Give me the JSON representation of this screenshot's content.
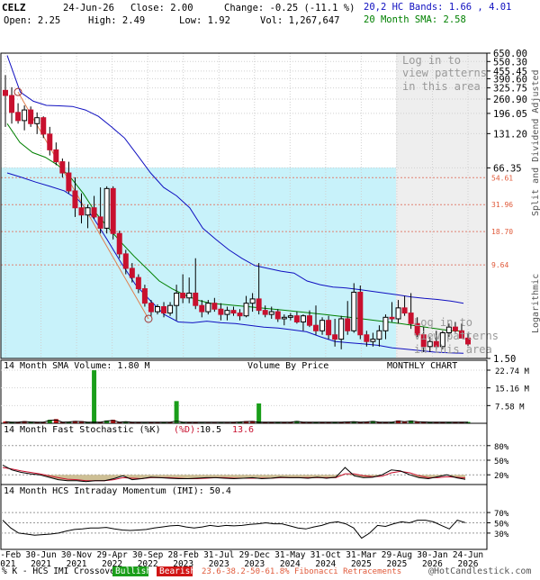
{
  "header": {
    "symbol": "CELZ",
    "date": "24-Jun-26",
    "close": "Close: 2.00",
    "change": "Change: -0.25 (-11.1 %)",
    "open": "Open: 2.25",
    "high": "High: 2.49",
    "low": "Low: 1.92",
    "vol": "Vol: 1,267,647",
    "bands": "20,2 HC Bands: 1.66 , 4.01",
    "sma": "20 Month SMA: 2.58"
  },
  "colors": {
    "up": "#ffffff",
    "down": "#c8102e",
    "bands": "#1010c0",
    "sma": "#008000",
    "fib_zone": "#c8f2fa",
    "right_zone": "#eeeeee",
    "fib_line": "#e08070",
    "vol_up": "#1a9e1a",
    "vol_down": "#d01515",
    "stoch_k": "#000000",
    "stoch_d": "#c8102e",
    "stoch_fill": "#cdbf95",
    "grid": "#d0d0d0"
  },
  "texts": {
    "login_top": [
      "Log in to",
      "view patterns",
      "in this area"
    ],
    "login_bottom": [
      "Log in to",
      "view patterns",
      "in this area"
    ],
    "split_adjusted": "Split and Dividend Adjusted",
    "logarithmic": "Logarithmic",
    "vol_sma": "14 Month SMA Volume: 1.80 M",
    "vbp": "Volume By Price",
    "monthly": "MONTHLY CHART",
    "stoch_title": "14 Month Fast Stochastic (%K)",
    "stoch_d_label": "(%D):",
    "stoch_k_val": "10.5",
    "stoch_d_val": "13.6",
    "imi_title": "14 Month HCS Intraday Momentum (IMI): 50.4",
    "footer_left": "% K - HCS IMI Crossover:",
    "bullish": "Bullish",
    "bearish": "Bearish",
    "fib_footer": "23.6-38.2-50-61.8% Fibonacci Retracements",
    "copyright": "@HotCandlestick.com"
  },
  "chart_data": [
    {
      "type": "candlestick",
      "panel": "price",
      "scale": "log",
      "ylim": [
        1.5,
        650
      ],
      "y_ticks": [
        "650.00",
        "550.30",
        "455.45",
        "390.60",
        "325.75",
        "260.90",
        "196.05",
        "131.20",
        "66.35",
        "1.50"
      ],
      "fib_levels": [
        "54.61",
        "31.96",
        "18.70",
        "9.64"
      ],
      "x_tick_labels": [
        [
          "26-Feb",
          "2021"
        ],
        [
          "30-Jun",
          "2021"
        ],
        [
          "30-Nov",
          "2021"
        ],
        [
          "29-Apr",
          "2022"
        ],
        [
          "30-Sep",
          "2022"
        ],
        [
          "28-Feb",
          "2023"
        ],
        [
          "31-Jul",
          "2023"
        ],
        [
          "29-Dec",
          "2023"
        ],
        [
          "31-May",
          "2024"
        ],
        [
          "31-Oct",
          "2024"
        ],
        [
          "31-Mar",
          "2025"
        ],
        [
          "29-Aug",
          "2025"
        ],
        [
          "30-Jan",
          "2026"
        ],
        [
          "24-Jun",
          "2026"
        ]
      ],
      "candles": [
        [
          310,
          420,
          150,
          280
        ],
        [
          280,
          330,
          160,
          200
        ],
        [
          200,
          240,
          160,
          170
        ],
        [
          170,
          230,
          140,
          210
        ],
        [
          210,
          225,
          150,
          160
        ],
        [
          160,
          200,
          130,
          180
        ],
        [
          180,
          185,
          120,
          130
        ],
        [
          130,
          150,
          85,
          95
        ],
        [
          95,
          110,
          70,
          75
        ],
        [
          75,
          80,
          55,
          60
        ],
        [
          60,
          75,
          40,
          42
        ],
        [
          42,
          55,
          25,
          30
        ],
        [
          30,
          40,
          22,
          26
        ],
        [
          26,
          32,
          20,
          30
        ],
        [
          30,
          38,
          24,
          25
        ],
        [
          25,
          45,
          18,
          20
        ],
        [
          20,
          46,
          18,
          44
        ],
        [
          44,
          46,
          16,
          18
        ],
        [
          18,
          19,
          11,
          12
        ],
        [
          12,
          13,
          8,
          9
        ],
        [
          9,
          10,
          6.8,
          7.5
        ],
        [
          7.5,
          8,
          5.5,
          6
        ],
        [
          6,
          6.5,
          4.2,
          4.5
        ],
        [
          4.5,
          4.8,
          3.5,
          3.8
        ],
        [
          3.8,
          4.4,
          3.6,
          4.2
        ],
        [
          4.2,
          4.6,
          3.4,
          3.7
        ],
        [
          3.7,
          4.6,
          3.5,
          4.3
        ],
        [
          4.3,
          6.5,
          3.2,
          5.5
        ],
        [
          5.5,
          8,
          4.5,
          5
        ],
        [
          5,
          7.5,
          4.5,
          5.5
        ],
        [
          5.5,
          11,
          4,
          4.3
        ],
        [
          4.3,
          4.8,
          3.4,
          3.8
        ],
        [
          3.8,
          4.8,
          3.6,
          4.5
        ],
        [
          4.5,
          5,
          3.8,
          4
        ],
        [
          4,
          4.5,
          3.2,
          3.6
        ],
        [
          3.6,
          4.2,
          3.2,
          3.9
        ],
        [
          3.9,
          4.2,
          3.5,
          3.7
        ],
        [
          3.7,
          4,
          3.2,
          3.5
        ],
        [
          3.5,
          5.2,
          3.4,
          4.5
        ],
        [
          4.5,
          5.5,
          3.8,
          4.9
        ],
        [
          4.9,
          10,
          3.6,
          3.9
        ],
        [
          3.9,
          4.3,
          3.4,
          3.6
        ],
        [
          3.6,
          4.2,
          3.3,
          3.8
        ],
        [
          3.8,
          4,
          3.1,
          3.3
        ],
        [
          3.3,
          3.6,
          2.9,
          3.4
        ],
        [
          3.4,
          3.7,
          3.2,
          3.5
        ],
        [
          3.5,
          3.8,
          3,
          3.1
        ],
        [
          3.1,
          3.6,
          2.6,
          3.5
        ],
        [
          3.5,
          3.9,
          2.8,
          2.9
        ],
        [
          2.9,
          4.3,
          2.4,
          2.6
        ],
        [
          2.6,
          3.4,
          2.4,
          3.2
        ],
        [
          3.2,
          3.5,
          2.2,
          2.4
        ],
        [
          2.4,
          3.3,
          1.9,
          2.2
        ],
        [
          2.2,
          3.5,
          1.8,
          3.3
        ],
        [
          3.3,
          4.7,
          2.4,
          2.6
        ],
        [
          2.6,
          6.7,
          2.5,
          5.6
        ],
        [
          5.6,
          6.4,
          2.2,
          2.4
        ],
        [
          2.4,
          2.6,
          1.9,
          2.1
        ],
        [
          2.1,
          2.5,
          1.9,
          2.2
        ],
        [
          2.2,
          2.9,
          1.9,
          2.6
        ],
        [
          2.6,
          3.6,
          2.2,
          3.4
        ],
        [
          3.4,
          4.6,
          3.1,
          3.3
        ],
        [
          3.3,
          4.8,
          3,
          4.1
        ],
        [
          4.1,
          5.2,
          3.5,
          3.7
        ],
        [
          3.7,
          5.5,
          2.7,
          3
        ],
        [
          3,
          3.4,
          2.3,
          2.4
        ],
        [
          2.4,
          2.8,
          1.7,
          1.9
        ],
        [
          1.9,
          2.3,
          1.7,
          2.1
        ],
        [
          2.1,
          2.6,
          1.8,
          1.9
        ],
        [
          1.9,
          2.6,
          1.8,
          2.5
        ],
        [
          2.5,
          3,
          2.3,
          2.8
        ],
        [
          2.8,
          3.1,
          2.5,
          2.6
        ],
        [
          2.6,
          3,
          2.3,
          2.25
        ],
        [
          2.25,
          2.49,
          1.92,
          2.0
        ]
      ],
      "upper_band": [
        620,
        300,
        250,
        230,
        228,
        225,
        210,
        185,
        150,
        120,
        85,
        60,
        45,
        38,
        30,
        20,
        16,
        13,
        11,
        9.5,
        9,
        8.5,
        8.2,
        7,
        6.5,
        6.2,
        6.1,
        5.9,
        5.7,
        5.5,
        5.3,
        5.1,
        4.95,
        4.85,
        4.7,
        4.5
      ],
      "lower_band": [
        60,
        55,
        50,
        46,
        42,
        35,
        25,
        16,
        10,
        6.5,
        4.8,
        3.6,
        3.1,
        3.05,
        3.15,
        3.05,
        3,
        2.9,
        2.8,
        2.75,
        2.65,
        2.55,
        2.3,
        2.1,
        2.05,
        2.0,
        1.95,
        1.85,
        1.8,
        1.75,
        1.7,
        1.68,
        1.66
      ],
      "sma20": [
        160,
        110,
        90,
        82,
        70,
        55,
        40,
        27,
        20,
        15,
        11.5,
        9,
        7,
        6,
        5.3,
        4.8,
        4.5,
        4.4,
        4.3,
        4.2,
        4.1,
        4.0,
        3.9,
        3.8,
        3.7,
        3.6,
        3.5,
        3.4,
        3.3,
        3.2,
        3.1,
        3.0,
        2.9,
        2.8,
        2.7,
        2.6,
        2.58
      ]
    },
    {
      "type": "bar",
      "panel": "volume",
      "y_ticks": [
        "22.74 M",
        "15.16 M",
        "7.58 M"
      ],
      "ylim": [
        0,
        22.74
      ],
      "volume": [
        0.8,
        0.6,
        0.5,
        0.9,
        0.7,
        0.5,
        0.4,
        1.5,
        1.8,
        0.5,
        0.7,
        1.0,
        0.9,
        0.5,
        0.6,
        0.6,
        1.2,
        1.5,
        0.6,
        0.8,
        0.5,
        0.4,
        0.3,
        0.5,
        0.5,
        0.4,
        0.5,
        1.2,
        0.5,
        0.5,
        0.4,
        0.3,
        0.3,
        0.3,
        0.3,
        0.3,
        0.5,
        0.7,
        0.9,
        1.0,
        0.5,
        0.4,
        0.5,
        0.6,
        0.4,
        0.5,
        1.0,
        0.6,
        0.5,
        0.5,
        0.5,
        0.5,
        0.6,
        0.5,
        0.7,
        0.8,
        0.6,
        0.7,
        1.0,
        0.5,
        0.5,
        0.6,
        1.2,
        0.8,
        1.2,
        0.8,
        0.7,
        0.6,
        0.6,
        0.6,
        0.6,
        0.6,
        0.6,
        0.6
      ]
    },
    {
      "type": "line",
      "panel": "stochastic",
      "y_ticks": [
        "80%",
        "50%",
        "20%"
      ],
      "ylim": [
        0,
        100
      ],
      "k": [
        40,
        30,
        25,
        22,
        20,
        15,
        10,
        8,
        8,
        6,
        8,
        8,
        12,
        18,
        10,
        12,
        15,
        14,
        13,
        12,
        12,
        13,
        14,
        14,
        13,
        12,
        13,
        14,
        12,
        13,
        15,
        14,
        14,
        13,
        15,
        13,
        15,
        35,
        18,
        14,
        15,
        20,
        30,
        28,
        20,
        14,
        12,
        16,
        20,
        14,
        10.5
      ],
      "d": [
        35,
        32,
        28,
        25,
        22,
        18,
        14,
        11,
        10,
        8,
        8,
        8,
        10,
        14,
        13,
        12,
        14,
        14,
        14,
        13,
        12,
        12,
        13,
        14,
        14,
        13,
        13,
        13,
        13,
        13,
        14,
        14,
        14,
        14,
        14,
        14,
        14,
        22,
        22,
        18,
        16,
        17,
        24,
        27,
        24,
        18,
        14,
        14,
        16,
        15,
        13.6
      ]
    },
    {
      "type": "line",
      "panel": "imi",
      "y_ticks": [
        "70%",
        "50%",
        "30%"
      ],
      "ylim": [
        0,
        100
      ],
      "imi": [
        55,
        40,
        30,
        28,
        26,
        27,
        28,
        30,
        34,
        37,
        38,
        40,
        40,
        41,
        38,
        36,
        35,
        36,
        37,
        40,
        42,
        44,
        45,
        42,
        40,
        42,
        45,
        43,
        45,
        44,
        45,
        47,
        48,
        50,
        48,
        48,
        44,
        40,
        38,
        42,
        45,
        50,
        52,
        48,
        40,
        20,
        30,
        45,
        43,
        48,
        52,
        50,
        55,
        55,
        52,
        45,
        38,
        55,
        50.4
      ]
    }
  ]
}
